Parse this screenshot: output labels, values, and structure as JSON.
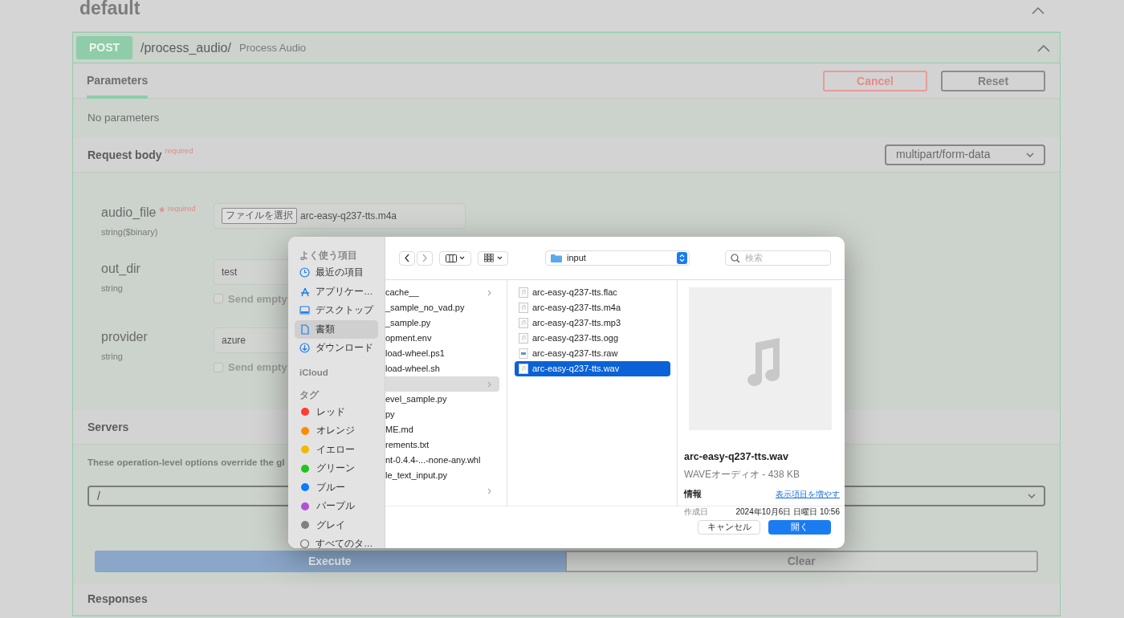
{
  "section": {
    "title": "default"
  },
  "operation": {
    "method": "POST",
    "path": "/process_audio/",
    "summary": "Process Audio",
    "expanded": true
  },
  "tabs": [
    {
      "label": "Parameters",
      "selected": true
    }
  ],
  "tab_buttons": [
    {
      "label": "Cancel",
      "kind": "danger"
    },
    {
      "label": "Reset",
      "kind": "plain"
    }
  ],
  "no_parameters": "No parameters",
  "request_body": {
    "title": "Request body",
    "required": "required",
    "content_type": "multipart/form-data"
  },
  "params": [
    {
      "kind": "file",
      "name": "audio_file",
      "required_mark": "*",
      "required": "required",
      "type": "string($binary)",
      "button": "ファイルを選択",
      "value": "arc-easy-q237-tts.m4a"
    },
    {
      "kind": "text",
      "name": "out_dir",
      "type": "string",
      "value": "test",
      "send_empty": "Send empty",
      "checked": false
    },
    {
      "kind": "text",
      "name": "provider",
      "type": "string",
      "value": "azure",
      "send_empty": "Send empty",
      "checked": false
    }
  ],
  "servers": {
    "title": "Servers",
    "description": "These operation-level options override the gl",
    "value": "/"
  },
  "actions": [
    {
      "label": "Execute",
      "kind": "primary"
    },
    {
      "label": "Clear",
      "kind": "plain"
    }
  ],
  "responses": {
    "title": "Responses"
  },
  "dialog": {
    "sidebar": [
      {
        "heading": "よく使う項目",
        "items": [
          {
            "label": "最近の項目",
            "kind": "recent",
            "selected": false
          },
          {
            "label": "アプリケー…",
            "kind": "apps",
            "selected": false
          },
          {
            "label": "デスクトップ",
            "kind": "desktop",
            "selected": false
          },
          {
            "label": "書類",
            "kind": "documents",
            "selected": true
          },
          {
            "label": "ダウンロード",
            "kind": "downloads",
            "selected": false
          }
        ]
      },
      {
        "heading": "iCloud"
      },
      {
        "heading": "タグ",
        "items": [
          {
            "label": "レッド",
            "kind": "tag",
            "color": "#ff3b30",
            "selected": false
          },
          {
            "label": "オレンジ",
            "kind": "tag",
            "color": "#ff8c00",
            "selected": false
          },
          {
            "label": "イエロー",
            "kind": "tag",
            "color": "#f5b800",
            "selected": false
          },
          {
            "label": "グリーン",
            "kind": "tag",
            "color": "#1fc41f",
            "selected": false
          },
          {
            "label": "ブルー",
            "kind": "tag",
            "color": "#0a7aff",
            "selected": false
          },
          {
            "label": "パープル",
            "kind": "tag",
            "color": "#b050d8",
            "selected": false
          },
          {
            "label": "グレイ",
            "kind": "tag",
            "color": "#808080",
            "selected": false
          },
          {
            "label": "すべてのタ…",
            "kind": "all_tags",
            "selected": false
          }
        ]
      }
    ],
    "location": "input",
    "search": {
      "placeholder": "検索"
    },
    "folder_column": [
      {
        "name": "cache__",
        "folder": true,
        "selected": false
      },
      {
        "name": "_sample_no_vad.py",
        "folder": false,
        "selected": false
      },
      {
        "name": "_sample.py",
        "folder": false,
        "selected": false
      },
      {
        "name": "opment.env",
        "folder": false,
        "selected": false
      },
      {
        "name": "load-wheel.ps1",
        "folder": false,
        "selected": false
      },
      {
        "name": "load-wheel.sh",
        "folder": false,
        "selected": false
      },
      {
        "folder": true,
        "selected": true
      },
      {
        "name": "evel_sample.py",
        "folder": false,
        "selected": false
      },
      {
        "name": "py",
        "folder": false,
        "selected": false
      },
      {
        "name": "ME.md",
        "folder": false,
        "selected": false
      },
      {
        "name": "rements.txt",
        "folder": false,
        "selected": false
      },
      {
        "name": "nt-0.4.4-...-none-any.whl",
        "folder": false,
        "selected": false
      },
      {
        "name": "le_text_input.py",
        "folder": false,
        "selected": false
      },
      {
        "folder": true,
        "selected": false
      }
    ],
    "files": [
      {
        "name": "arc-easy-q237-tts.flac",
        "kind": "audio",
        "selected": false
      },
      {
        "name": "arc-easy-q237-tts.m4a",
        "kind": "audio",
        "selected": false
      },
      {
        "name": "arc-easy-q237-tts.mp3",
        "kind": "audio",
        "selected": false
      },
      {
        "name": "arc-easy-q237-tts.ogg",
        "kind": "audio",
        "selected": false
      },
      {
        "name": "arc-easy-q237-tts.raw",
        "kind": "raw",
        "selected": false
      },
      {
        "name": "arc-easy-q237-tts.wav",
        "kind": "audio",
        "selected": true
      }
    ],
    "preview": {
      "name": "arc-easy-q237-tts.wav",
      "subtitle": "WAVEオーディオ - 438 KB",
      "info_heading": "情報",
      "more_link": "表示項目を増やす",
      "rows": [
        {
          "label": "作成日",
          "value": "2024年10月6日 日曜日 10:56"
        }
      ]
    },
    "buttons": [
      {
        "label": "キャンセル",
        "kind": "cancel"
      },
      {
        "label": "開く",
        "kind": "default"
      }
    ]
  }
}
